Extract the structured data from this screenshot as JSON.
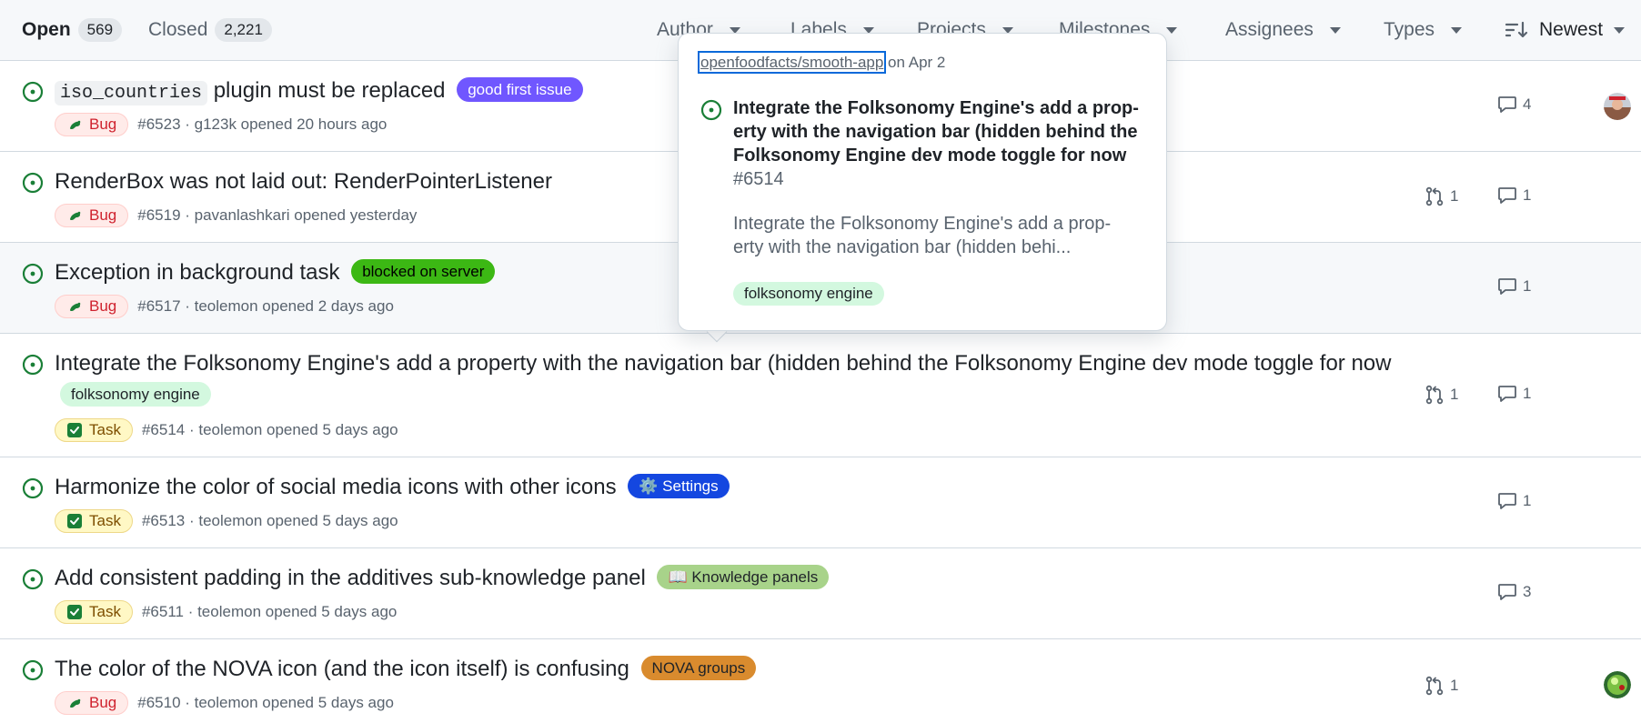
{
  "header": {
    "open_label": "Open",
    "open_count": "569",
    "closed_label": "Closed",
    "closed_count": "2,221",
    "filters": [
      "Author",
      "Labels",
      "Projects",
      "Milestones",
      "Assignees",
      "Types"
    ],
    "sort_label": "Newest"
  },
  "issues": [
    {
      "title_code": "iso_countries",
      "title": "plugin must be replaced",
      "labels": [
        {
          "text": "good first issue",
          "bg": "#7057ff",
          "fg": "#ffffff"
        }
      ],
      "type": "Bug",
      "meta": "#6523 · g123k opened 20 hours ago",
      "pr": "",
      "comments": "4",
      "avatar": "avatar-1"
    },
    {
      "title": "RenderBox was not laid out: RenderPointerListener",
      "labels": [],
      "type": "Bug",
      "meta": "#6519 · pavanlashkari opened yesterday",
      "pr": "1",
      "comments": "1"
    },
    {
      "title": "Exception in background task",
      "labels": [
        {
          "text": "blocked on server",
          "bg": "#3cb814",
          "fg": "#000000"
        }
      ],
      "type": "Bug",
      "meta": "#6517 · teolemon opened 2 days ago",
      "pr": "",
      "comments": "1"
    },
    {
      "title": "Integrate the Folksonomy Engine's add a property with the navigation bar (hidden behind the Folksonomy Engine dev mode toggle for now",
      "labels": [
        {
          "text": "folksonomy engine",
          "bg": "#d3f8df",
          "fg": "#1f2328"
        }
      ],
      "type": "Task",
      "meta": "#6514 · teolemon opened 5 days ago",
      "pr": "1",
      "comments": "1"
    },
    {
      "title": "Harmonize the color of social media icons with other icons",
      "labels": [
        {
          "text": "⚙️ Settings",
          "bg": "#1447e0",
          "fg": "#ffffff"
        }
      ],
      "type": "Task",
      "meta": "#6513 · teolemon opened 5 days ago",
      "pr": "",
      "comments": "1"
    },
    {
      "title": "Add consistent padding in the additives sub-knowledge panel",
      "labels": [
        {
          "text": "📖 Knowledge panels",
          "bg": "#a8d38a",
          "fg": "#1f2328"
        }
      ],
      "type": "Task",
      "meta": "#6511 · teolemon opened 5 days ago",
      "pr": "",
      "comments": "3"
    },
    {
      "title": "The color of the NOVA icon (and the icon itself) is confusing",
      "labels": [
        {
          "text": "NOVA groups",
          "bg": "#d98b2e",
          "fg": "#1f2328"
        }
      ],
      "type": "Bug",
      "meta": "#6510 · teolemon opened 5 days ago",
      "pr": "1",
      "comments": "",
      "avatar": "avatar-2"
    }
  ],
  "popover": {
    "repo": "openfoodfacts/smooth-app",
    "date": "on Apr 2",
    "title": "Integrate the Folksonomy Engine's add a prop-erty with the navigation bar (hidden behind the Folksonomy Engine dev mode toggle for now",
    "number": "#6514",
    "body": "Integrate the Folksonomy Engine's add a prop-erty with the navigation bar (hidden behi...",
    "label": "folksonomy engine"
  },
  "colors": {
    "open_icon": "#1a7f37",
    "bug_fg": "#cf222e",
    "task_check": "#1a7f37",
    "link_focus": "#0969da"
  }
}
